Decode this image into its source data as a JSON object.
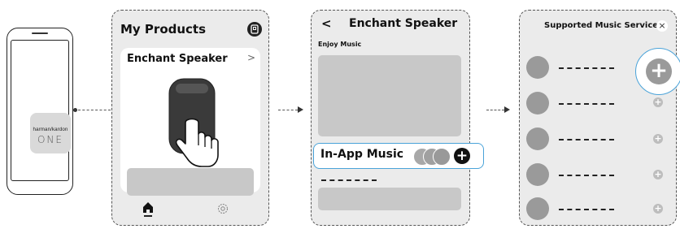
{
  "phone": {
    "brand": "harman/kardon",
    "logo_word": "ONE"
  },
  "panel1": {
    "title": "My Products",
    "device_name": "Enchant Speaker",
    "chevron": ">"
  },
  "panel2": {
    "back": "<",
    "title": "Enchant Speaker",
    "section": "Enjoy Music",
    "in_app_label": "In-App Music"
  },
  "panel3": {
    "title": "Supported Music Services",
    "close": "×",
    "rows": 5
  },
  "icons": {
    "plus": "+",
    "home": "home-icon",
    "settings": "gear-icon"
  }
}
